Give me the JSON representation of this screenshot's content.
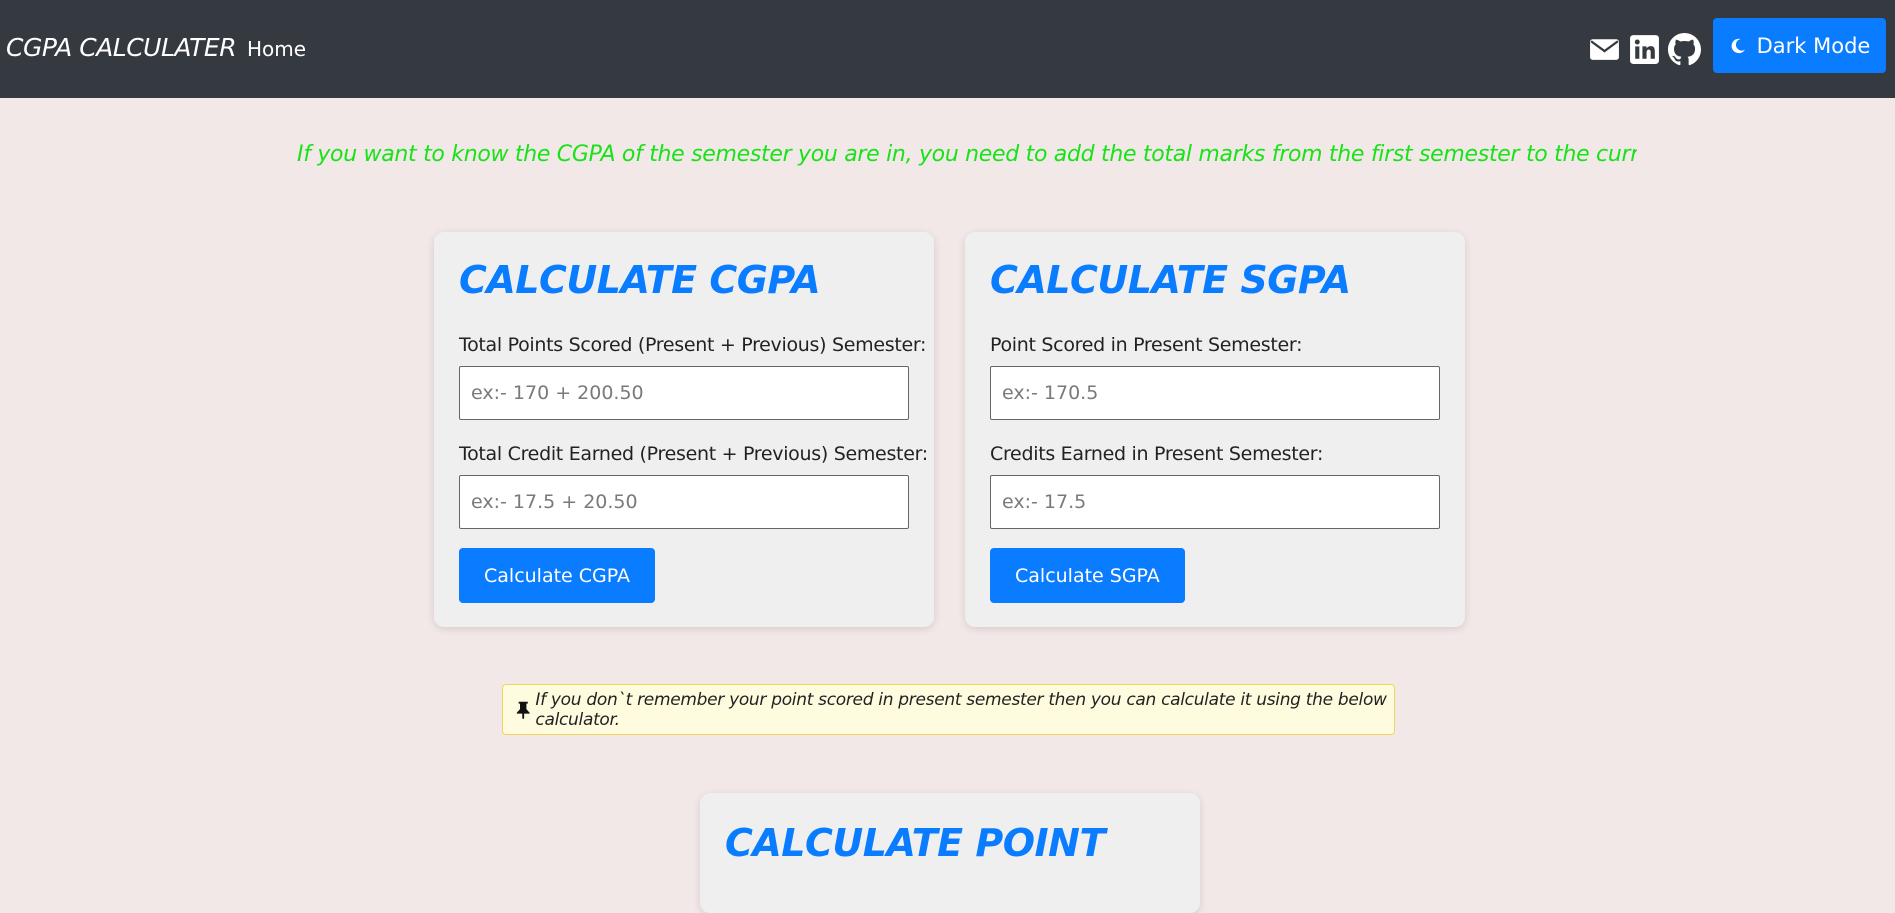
{
  "navbar": {
    "brand": "CGPA CALCULATER",
    "home_label": "Home",
    "icons": [
      "envelope-icon",
      "linkedin-icon",
      "github-icon"
    ],
    "dark_mode_label": "Dark Mode"
  },
  "marquee": {
    "text": "If you want to know the CGPA of the semester you are in, you need to add the total marks from the first semester to the current semester. E"
  },
  "cgpa_card": {
    "title": "CALCULATE CGPA",
    "points_label": "Total Points Scored (Present + Previous) Semester:",
    "points_placeholder": "ex:- 170 + 200.50",
    "credits_label": "Total Credit Earned (Present + Previous) Semester:",
    "credits_placeholder": "ex:- 17.5 + 20.50",
    "button_label": "Calculate CGPA"
  },
  "sgpa_card": {
    "title": "CALCULATE SGPA",
    "points_label": "Point Scored in Present Semester:",
    "points_placeholder": "ex:- 170.5",
    "credits_label": "Credits Earned in Present Semester:",
    "credits_placeholder": "ex:- 17.5",
    "button_label": "Calculate SGPA"
  },
  "note": {
    "icon": "pushpin-icon",
    "text": "If you don`t remember your point scored in present semester then you can calculate it using the below calculator."
  },
  "point_card": {
    "title": "CALCULATE POINT"
  },
  "colors": {
    "navbar_bg": "#343a40",
    "accent": "#0a7cff",
    "marquee_text": "#18e218",
    "page_bg": "#f2e8e7",
    "card_bg": "#efefef",
    "note_bg": "#fffbde"
  }
}
